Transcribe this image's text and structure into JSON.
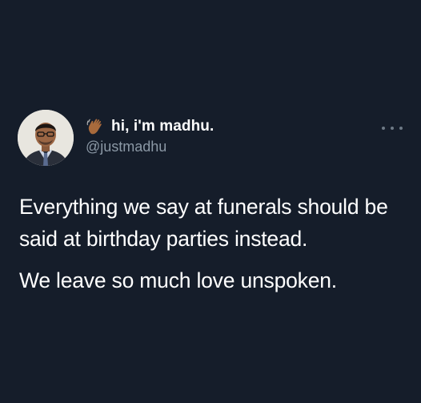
{
  "tweet": {
    "author": {
      "display_name": "hi, i'm madhu.",
      "handle": "@justmadhu",
      "name_emoji": "waving-hand-icon",
      "avatar": "profile-photo"
    },
    "menu_icon": "more-options-icon",
    "paragraphs": [
      "Everything we say at funerals should be said at birthday parties instead.",
      "We leave so much love unspoken."
    ]
  },
  "colors": {
    "background": "#151d2a",
    "text_primary": "#ffffff",
    "text_secondary": "#8b98a5"
  }
}
